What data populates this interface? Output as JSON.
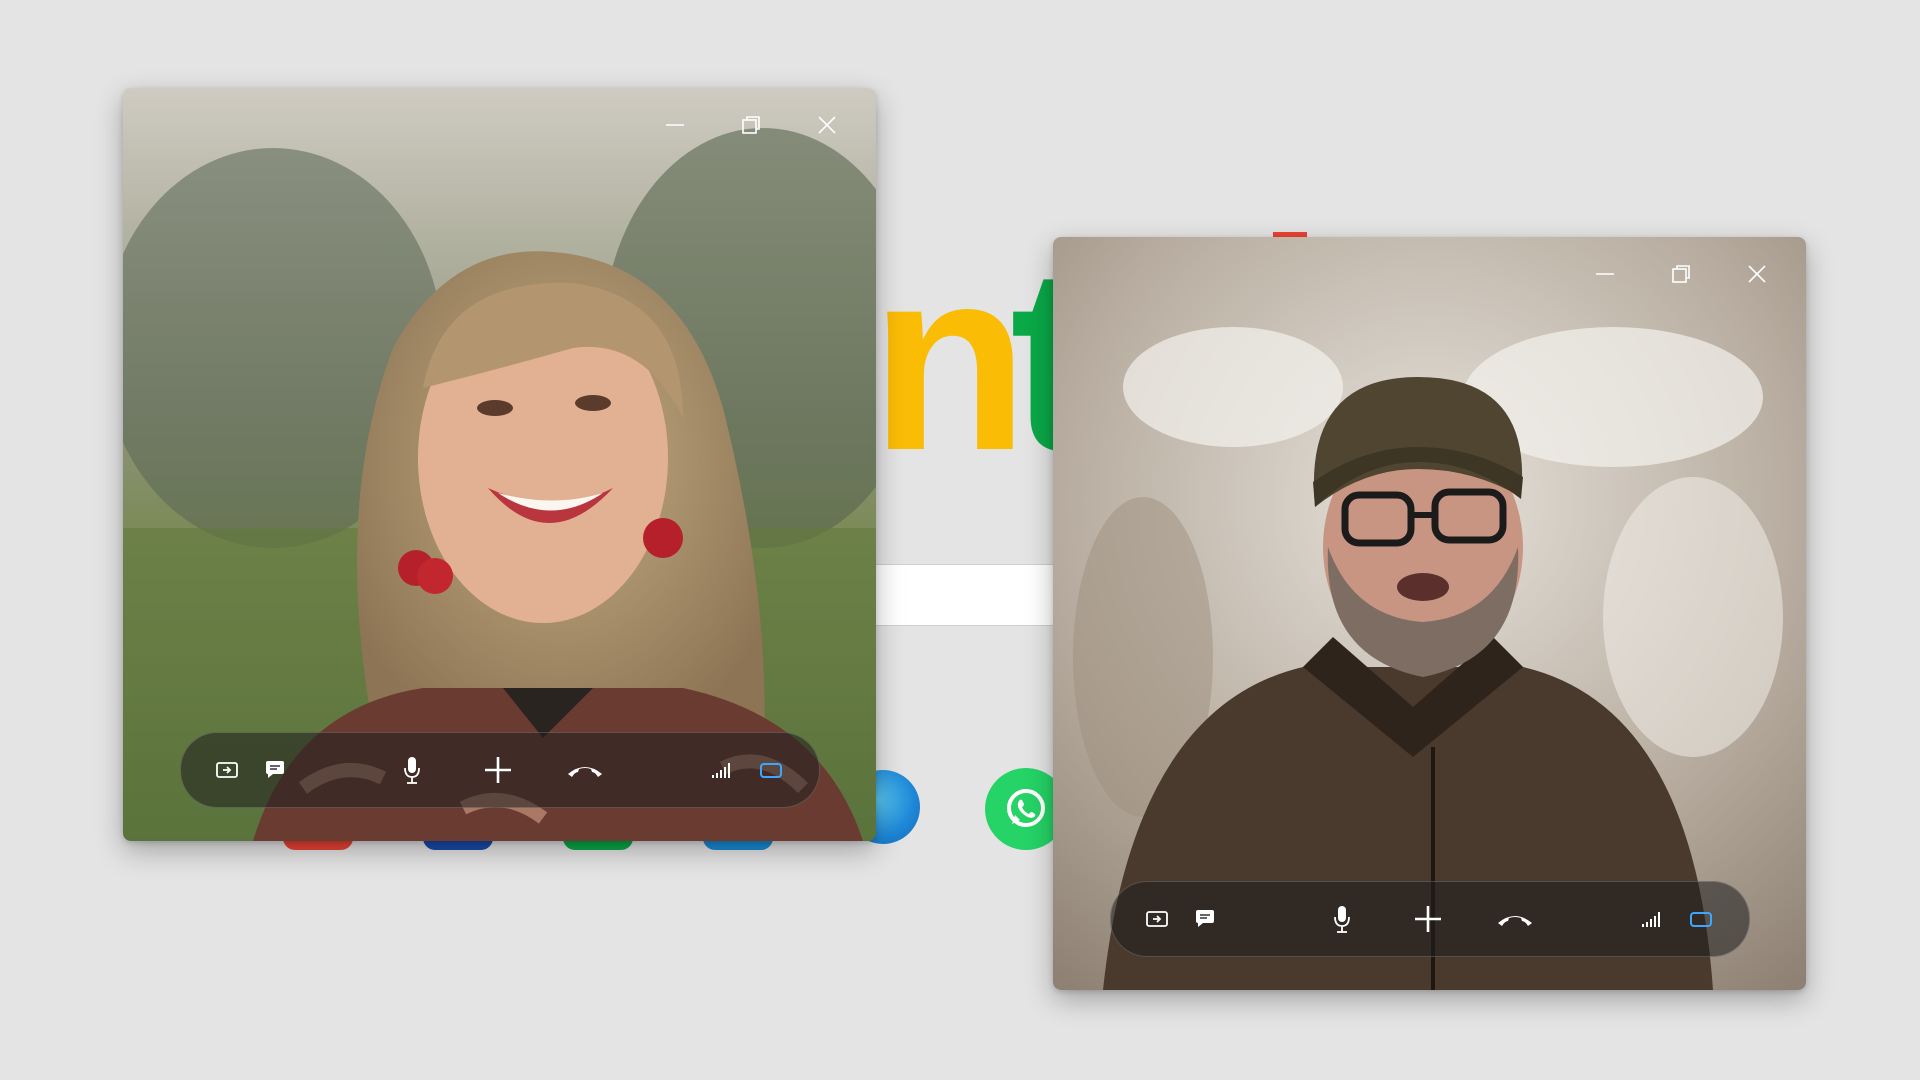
{
  "background": {
    "brand_letters": [
      "n",
      "t"
    ],
    "colors": {
      "page": "#e4e4e4",
      "letter_n": "#fbbc05",
      "letter_t": "#0aa847",
      "whatsapp": "#25d366",
      "red_accent": "#ea4335",
      "blue_accent": "#1a73e8"
    },
    "apps": [
      "globe-app-icon",
      "whatsapp-app-icon"
    ]
  },
  "windows": [
    {
      "id": "call-window-1",
      "participant": "woman",
      "controls": [
        "minimize-icon",
        "restore-icon",
        "close-icon"
      ],
      "call_bar": [
        "share-screen-icon",
        "chat-icon",
        "microphone-icon",
        "add-icon",
        "end-call-icon",
        "signal-icon",
        "video-icon"
      ]
    },
    {
      "id": "call-window-2",
      "participant": "man",
      "controls": [
        "minimize-icon",
        "restore-icon",
        "close-icon"
      ],
      "call_bar": [
        "share-screen-icon",
        "chat-icon",
        "microphone-icon",
        "add-icon",
        "end-call-icon",
        "signal-icon",
        "video-icon"
      ]
    }
  ],
  "accent": "#3ea6ff"
}
